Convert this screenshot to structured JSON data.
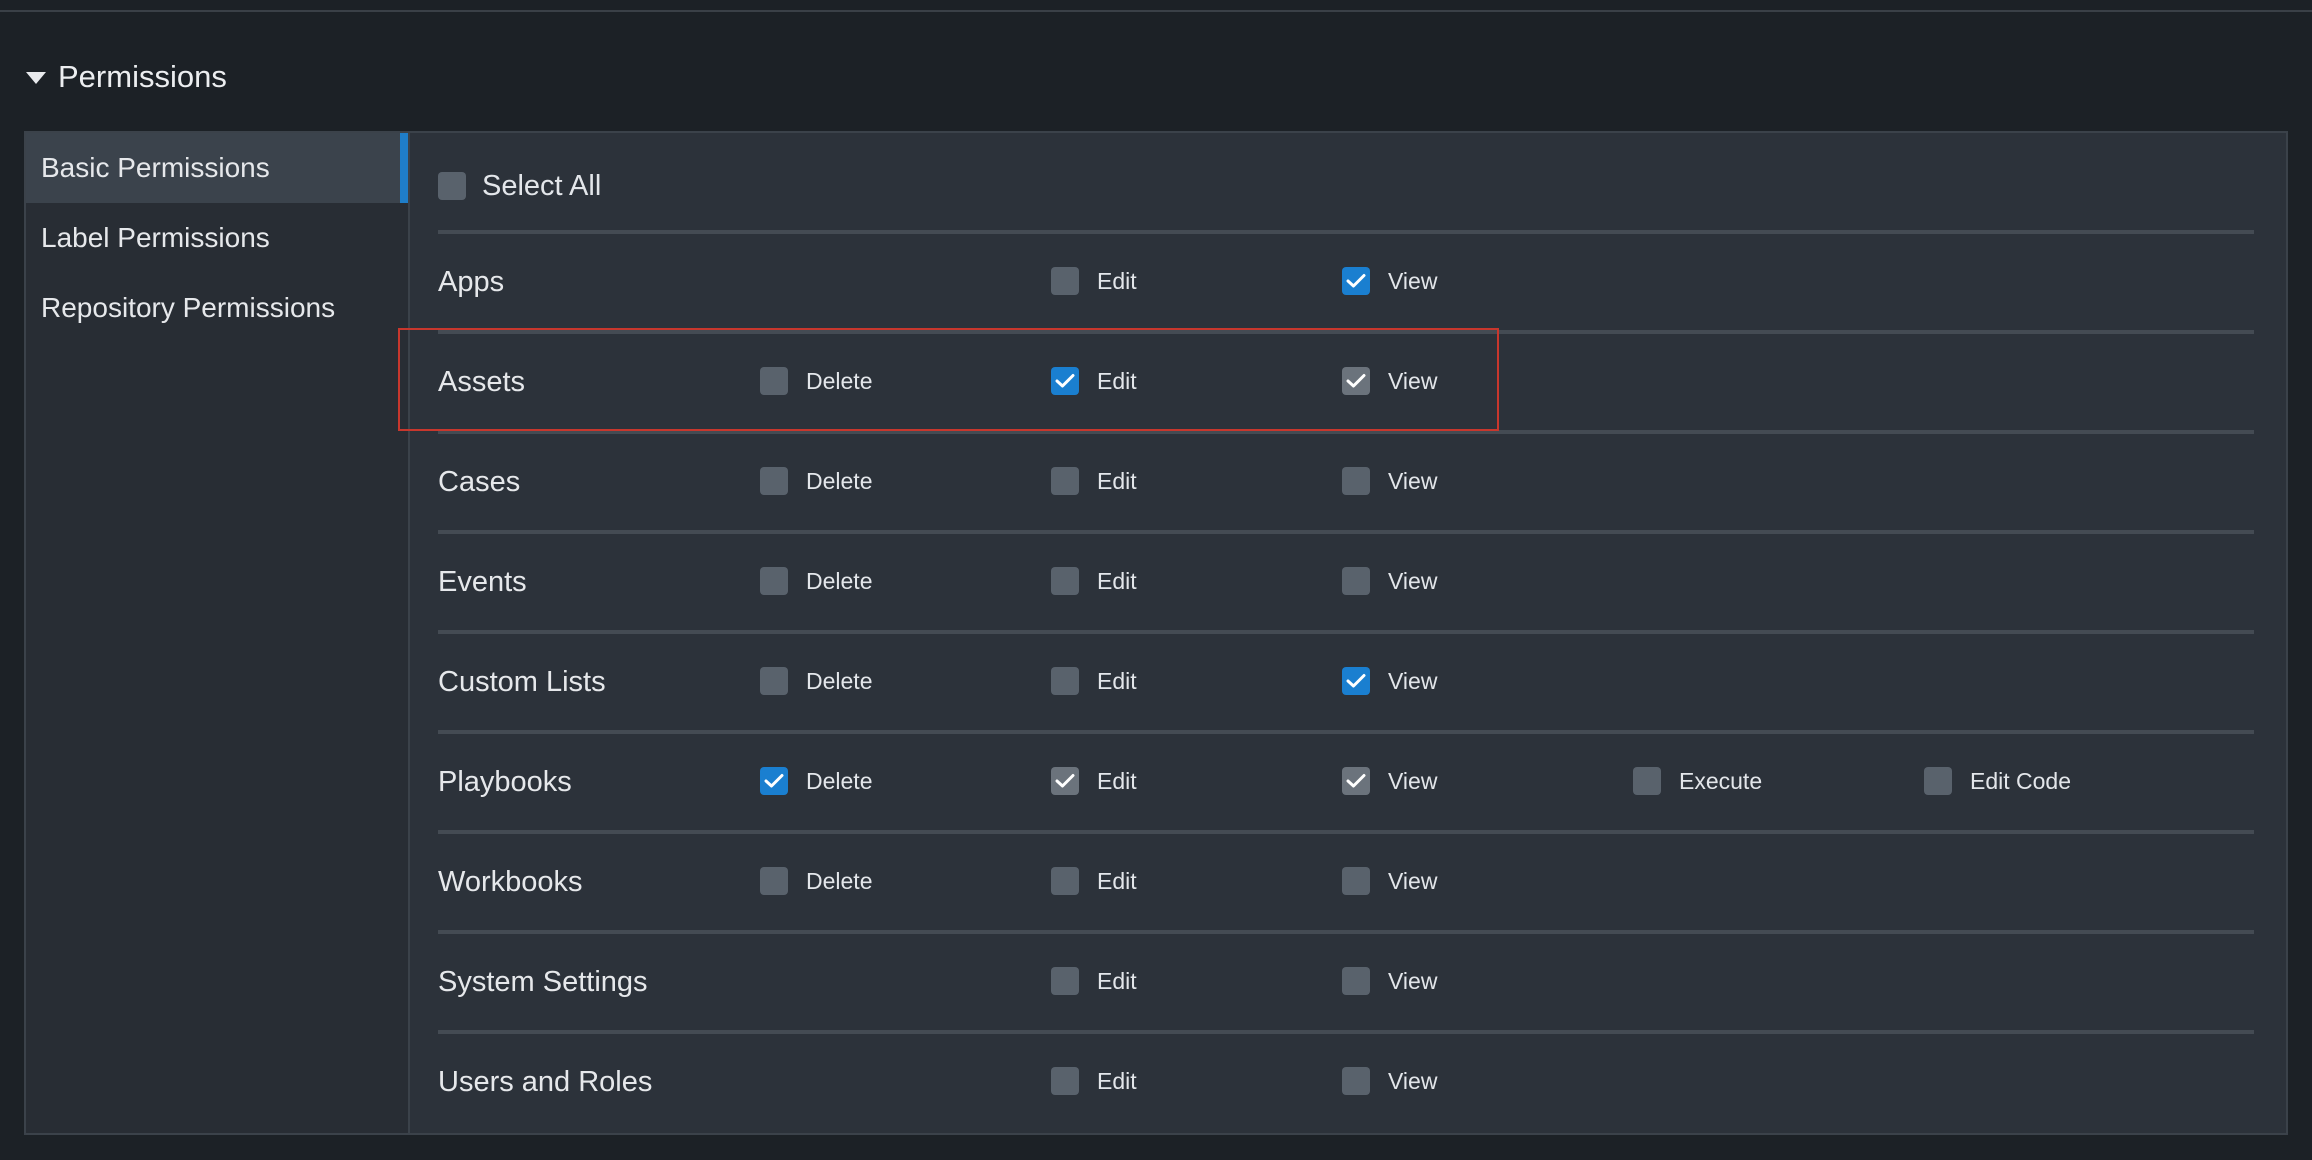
{
  "section": {
    "title": "Permissions",
    "caret_icon": "caret-down-icon"
  },
  "sidebar": {
    "items": [
      {
        "label": "Basic Permissions",
        "active": true
      },
      {
        "label": "Label Permissions",
        "active": false
      },
      {
        "label": "Repository Permissions",
        "active": false
      }
    ]
  },
  "select_all": {
    "label": "Select All",
    "checked": false
  },
  "rows": [
    {
      "label": "Apps",
      "perms": [
        {
          "col": 1,
          "label": "Edit",
          "state": "unchecked"
        },
        {
          "col": 2,
          "label": "View",
          "state": "checked"
        }
      ]
    },
    {
      "label": "Assets",
      "perms": [
        {
          "col": 0,
          "label": "Delete",
          "state": "unchecked"
        },
        {
          "col": 1,
          "label": "Edit",
          "state": "checked"
        },
        {
          "col": 2,
          "label": "View",
          "state": "implied"
        }
      ]
    },
    {
      "label": "Cases",
      "perms": [
        {
          "col": 0,
          "label": "Delete",
          "state": "unchecked"
        },
        {
          "col": 1,
          "label": "Edit",
          "state": "unchecked"
        },
        {
          "col": 2,
          "label": "View",
          "state": "unchecked"
        }
      ]
    },
    {
      "label": "Events",
      "perms": [
        {
          "col": 0,
          "label": "Delete",
          "state": "unchecked"
        },
        {
          "col": 1,
          "label": "Edit",
          "state": "unchecked"
        },
        {
          "col": 2,
          "label": "View",
          "state": "unchecked"
        }
      ]
    },
    {
      "label": "Custom Lists",
      "perms": [
        {
          "col": 0,
          "label": "Delete",
          "state": "unchecked"
        },
        {
          "col": 1,
          "label": "Edit",
          "state": "unchecked"
        },
        {
          "col": 2,
          "label": "View",
          "state": "checked"
        }
      ]
    },
    {
      "label": "Playbooks",
      "perms": [
        {
          "col": 0,
          "label": "Delete",
          "state": "checked"
        },
        {
          "col": 1,
          "label": "Edit",
          "state": "implied"
        },
        {
          "col": 2,
          "label": "View",
          "state": "implied"
        },
        {
          "col": 3,
          "label": "Execute",
          "state": "unchecked"
        },
        {
          "col": 4,
          "label": "Edit Code",
          "state": "unchecked"
        }
      ]
    },
    {
      "label": "Workbooks",
      "perms": [
        {
          "col": 0,
          "label": "Delete",
          "state": "unchecked"
        },
        {
          "col": 1,
          "label": "Edit",
          "state": "unchecked"
        },
        {
          "col": 2,
          "label": "View",
          "state": "unchecked"
        }
      ]
    },
    {
      "label": "System Settings",
      "perms": [
        {
          "col": 1,
          "label": "Edit",
          "state": "unchecked"
        },
        {
          "col": 2,
          "label": "View",
          "state": "unchecked"
        }
      ]
    },
    {
      "label": "Users and Roles",
      "perms": [
        {
          "col": 1,
          "label": "Edit",
          "state": "unchecked"
        },
        {
          "col": 2,
          "label": "View",
          "state": "unchecked"
        }
      ]
    }
  ],
  "colors": {
    "checked": "#1a7fd0",
    "implied": "#6b737c",
    "unchecked": "#59626c",
    "active_indicator": "#1f7ec9",
    "highlight": "#c8372d"
  }
}
